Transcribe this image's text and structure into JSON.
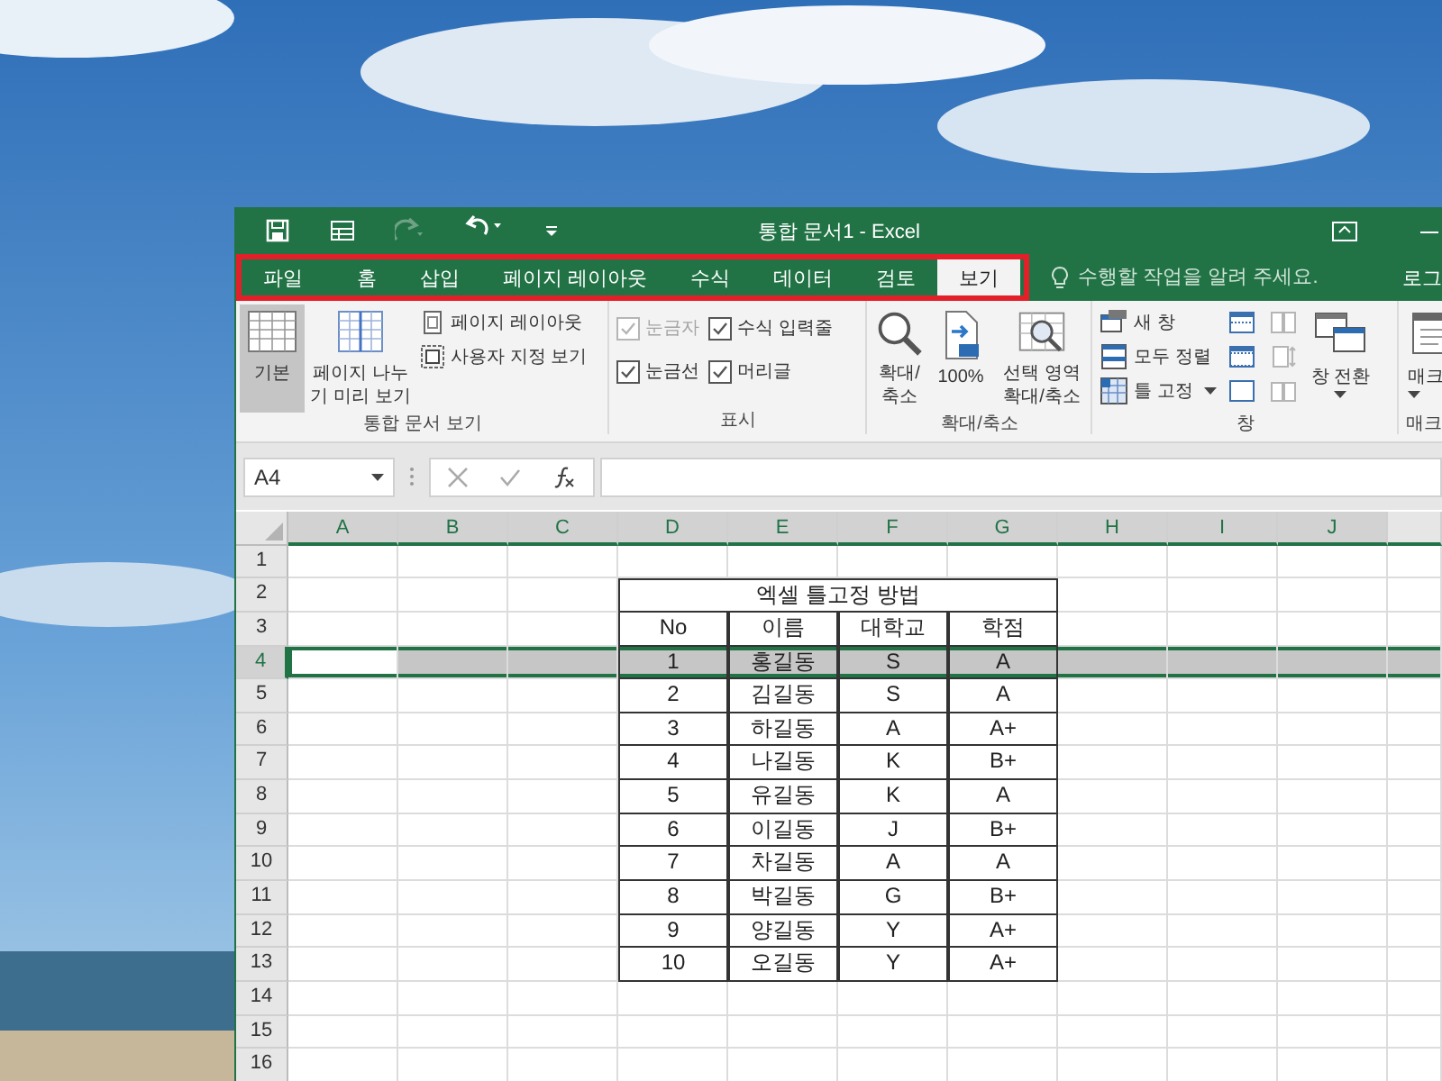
{
  "window": {
    "title": "통합 문서1 - Excel"
  },
  "quick_access": [
    {
      "kind": "save",
      "disabled": false
    },
    {
      "kind": "touch",
      "disabled": false
    },
    {
      "kind": "redo",
      "disabled": true
    },
    {
      "kind": "undo",
      "disabled": false
    },
    {
      "kind": "customize",
      "disabled": false
    }
  ],
  "tabs_highlighted": true,
  "tabs": [
    {
      "label": "파일",
      "selected": false
    },
    {
      "label": "홈",
      "selected": false
    },
    {
      "label": "삽입",
      "selected": false
    },
    {
      "label": "페이지 레이아웃",
      "selected": false
    },
    {
      "label": "수식",
      "selected": false
    },
    {
      "label": "데이터",
      "selected": false
    },
    {
      "label": "검토",
      "selected": false
    },
    {
      "label": "보기",
      "selected": true
    }
  ],
  "tell_me": {
    "placeholder": "수행할 작업을 알려 주세요."
  },
  "account": "로그",
  "ribbon": {
    "groups": [
      {
        "label": "통합 문서 보기",
        "columns": [
          [
            {
              "kind": "large",
              "label": "기본",
              "selected": true
            }
          ],
          [
            {
              "kind": "large",
              "label": "페이지 나누기 미리 보기",
              "selected": false
            }
          ],
          [
            {
              "kind": "small",
              "label": "페이지 레이아웃"
            },
            {
              "kind": "small",
              "label": "사용자 지정 보기"
            }
          ]
        ]
      },
      {
        "label": "표시",
        "columns": [
          [
            {
              "kind": "check",
              "label": "눈금자",
              "checked": true,
              "disabled": true
            },
            {
              "kind": "check",
              "label": "눈금선",
              "checked": true,
              "disabled": false
            }
          ],
          [
            {
              "kind": "check",
              "label": "수식 입력줄",
              "checked": true,
              "disabled": false
            },
            {
              "kind": "check",
              "label": "머리글",
              "checked": true,
              "disabled": false
            }
          ]
        ]
      },
      {
        "label": "확대/축소",
        "columns": [
          [
            {
              "kind": "large",
              "label": "확대/축소",
              "selected": false
            }
          ],
          [
            {
              "kind": "large",
              "label": "100%",
              "selected": false
            }
          ],
          [
            {
              "kind": "large",
              "label": "선택 영역 확대/축소",
              "selected": false
            }
          ]
        ]
      },
      {
        "label": "창",
        "columns": [
          [
            {
              "kind": "small",
              "label": "새 창"
            },
            {
              "kind": "small",
              "label": "모두 정렬"
            },
            {
              "kind": "small",
              "label": "틀 고정",
              "dropdown": true
            }
          ],
          [
            {
              "kind": "icon",
              "disabled": false
            },
            {
              "kind": "icon",
              "disabled": false
            },
            {
              "kind": "icon",
              "disabled": false
            }
          ],
          [
            {
              "kind": "icon",
              "disabled": true
            },
            {
              "kind": "icon",
              "disabled": true
            },
            {
              "kind": "icon",
              "disabled": true
            }
          ],
          [
            {
              "kind": "large",
              "label": "창 전환",
              "selected": false,
              "dropdown": true
            }
          ]
        ]
      },
      {
        "label": "매크",
        "columns": [
          [
            {
              "kind": "large",
              "label": "매크",
              "selected": false,
              "dropdown": true
            }
          ]
        ]
      }
    ]
  },
  "formula_bar": {
    "name_box": "A4"
  },
  "sheet": {
    "columns": [
      {
        "label": "A",
        "selected": true
      },
      {
        "label": "B",
        "selected": true
      },
      {
        "label": "C",
        "selected": true
      },
      {
        "label": "D",
        "selected": true
      },
      {
        "label": "E",
        "selected": true
      },
      {
        "label": "F",
        "selected": true
      },
      {
        "label": "G",
        "selected": true
      },
      {
        "label": "H",
        "selected": true
      },
      {
        "label": "I",
        "selected": true
      },
      {
        "label": "J",
        "selected": true
      }
    ],
    "rows": [
      {
        "label": "1",
        "selected": false,
        "kind": "empty"
      },
      {
        "label": "2",
        "selected": false,
        "kind": "title",
        "cells": [
          "엑셀 틀고정 방법"
        ]
      },
      {
        "label": "3",
        "selected": false,
        "kind": "data",
        "cells": [
          "No",
          "이름",
          "대학교",
          "학점"
        ]
      },
      {
        "label": "4",
        "selected": true,
        "kind": "data",
        "cells": [
          "1",
          "홍길동",
          "S",
          "A"
        ]
      },
      {
        "label": "5",
        "selected": false,
        "kind": "data",
        "cells": [
          "2",
          "김길동",
          "S",
          "A"
        ]
      },
      {
        "label": "6",
        "selected": false,
        "kind": "data",
        "cells": [
          "3",
          "하길동",
          "A",
          "A+"
        ]
      },
      {
        "label": "7",
        "selected": false,
        "kind": "data",
        "cells": [
          "4",
          "나길동",
          "K",
          "B+"
        ]
      },
      {
        "label": "8",
        "selected": false,
        "kind": "data",
        "cells": [
          "5",
          "유길동",
          "K",
          "A"
        ]
      },
      {
        "label": "9",
        "selected": false,
        "kind": "data",
        "cells": [
          "6",
          "이길동",
          "J",
          "B+"
        ]
      },
      {
        "label": "10",
        "selected": false,
        "kind": "data",
        "cells": [
          "7",
          "차길동",
          "A",
          "A"
        ]
      },
      {
        "label": "11",
        "selected": false,
        "kind": "data",
        "cells": [
          "8",
          "박길동",
          "G",
          "B+"
        ]
      },
      {
        "label": "12",
        "selected": false,
        "kind": "data",
        "cells": [
          "9",
          "양길동",
          "Y",
          "A+"
        ]
      },
      {
        "label": "13",
        "selected": false,
        "kind": "data",
        "cells": [
          "10",
          "오길동",
          "Y",
          "A+"
        ]
      },
      {
        "label": "14",
        "selected": false,
        "kind": "empty"
      },
      {
        "label": "15",
        "selected": false,
        "kind": "empty"
      },
      {
        "label": "16",
        "selected": false,
        "kind": "empty"
      }
    ]
  }
}
